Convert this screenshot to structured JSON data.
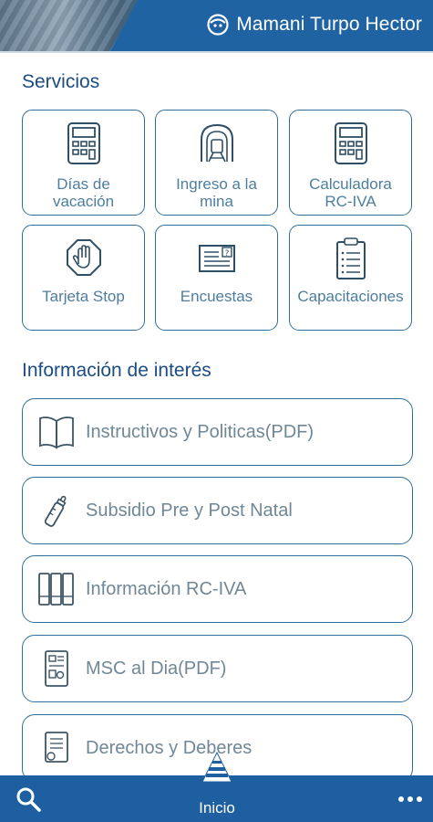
{
  "header": {
    "user_name": "Mamani Turpo Hector"
  },
  "services": {
    "title": "Servicios",
    "tiles": [
      {
        "label": "Días de vacación",
        "icon": "calculator-icon"
      },
      {
        "label": "Ingreso a la mina",
        "icon": "mine-tunnel-icon"
      },
      {
        "label": "Calculadora RC-IVA",
        "icon": "calculator-icon"
      },
      {
        "label": "Tarjeta Stop",
        "icon": "stop-hand-icon"
      },
      {
        "label": "Encuestas",
        "icon": "survey-form-icon"
      },
      {
        "label": "Capacitaciones",
        "icon": "clipboard-list-icon"
      }
    ]
  },
  "info": {
    "title": "Información de interés",
    "items": [
      {
        "label": "Instructivos y Politicas(PDF)",
        "icon": "open-book-icon"
      },
      {
        "label": "Subsidio Pre y Post Natal",
        "icon": "baby-bottle-icon"
      },
      {
        "label": "Información RC-IVA",
        "icon": "binders-icon"
      },
      {
        "label": "MSC al Dia(PDF)",
        "icon": "document-icon"
      },
      {
        "label": "Derechos y Deberes",
        "icon": "certificate-icon"
      }
    ]
  },
  "bottom_nav": {
    "home_label": "Inicio"
  },
  "colors": {
    "primary": "#1d5fa0",
    "border": "#2f6e9c",
    "title": "#1b4c84",
    "label": "#4d7e9d"
  }
}
